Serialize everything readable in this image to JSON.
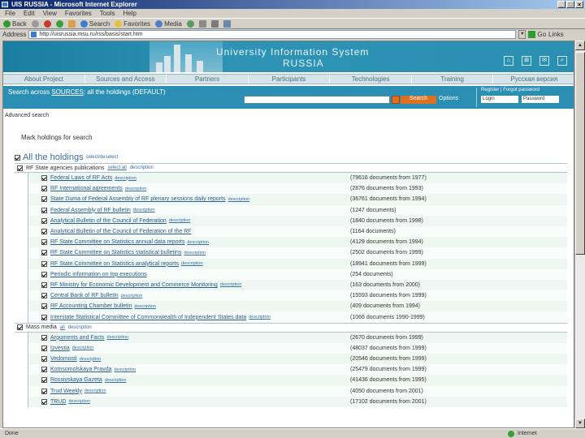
{
  "window": {
    "title": "UIS RUSSIA - Microsoft Internet Explorer",
    "menu": [
      "File",
      "Edit",
      "View",
      "Favorites",
      "Tools",
      "Help"
    ],
    "toolbar": {
      "back": "Back",
      "search": "Search",
      "favorites": "Favorites",
      "media": "Media"
    },
    "address": {
      "label": "Address",
      "url": "http://uisrussia.msu.ru/rss/basis/start.htm",
      "go": "Go",
      "links": "Links"
    },
    "status": {
      "left": "Done",
      "right": "Internet"
    }
  },
  "banner": {
    "line1": "University Information System",
    "line2": "RUSSIA"
  },
  "nav": [
    "About Project",
    "Sources and Access",
    "Partners",
    "Participants",
    "Technologies",
    "Training",
    "Русская версия"
  ],
  "search": {
    "prefix": "Search across",
    "link": "SOURCES",
    "suffix": ": all the holdings (DEFAULT)",
    "button": "Search",
    "options": "Options",
    "register": "Register | Forgot password",
    "login_placeholder": "Login",
    "password_placeholder": "Password"
  },
  "breadcrumb": "Advanced search",
  "section_title": "Mark holdings for search",
  "all_holdings": {
    "label": "All the holdings",
    "sub": "select/deselect"
  },
  "groups": [
    {
      "label": "RF State agencies publications",
      "select": "select all",
      "info": "description",
      "rows": [
        {
          "name": "Federal Laws of RF Acts",
          "desc": "description",
          "count": "(79616 documents from 1977)"
        },
        {
          "name": "RF International agreements",
          "desc": "description",
          "count": "(2876 documents from 1993)"
        },
        {
          "name": "State Duma of Federal Assembly of RF plenary sessions daily reports",
          "desc": "description",
          "count": "(36761 documents from 1994)"
        },
        {
          "name": "Federal Assembly of RF bulletin",
          "desc": "description",
          "count": "(1247 documents)"
        },
        {
          "name": "Analytical Bulletin of the Council of Federation",
          "desc": "description",
          "count": "(1840 documents from 1998)"
        },
        {
          "name": "Analytical Bulletin of the Council of Federation of the RF",
          "desc": "",
          "count": "(1164 documents)"
        },
        {
          "name": "RF State Committee on Statistics annual data reports",
          "desc": "description",
          "count": "(4129 documents from 1994)"
        },
        {
          "name": "RF State Committee on Statistics statistical bulletins",
          "desc": "description",
          "count": "(2502 documents from 1999)"
        },
        {
          "name": "RF State Committee on Statistics analytical reports",
          "desc": "description",
          "count": "(18941 documents from 1999)"
        },
        {
          "name": "Periodic information on top executions",
          "desc": "",
          "count": "(254 documents)"
        },
        {
          "name": "RF Ministry for Economic Development and Commerce Monitoring",
          "desc": "description",
          "count": "(163 documents from 2000)"
        },
        {
          "name": "Central Bank of RF bulletin",
          "desc": "description",
          "count": "(15593 documents from 1999)"
        },
        {
          "name": "RF Accounting Chamber bulletin",
          "desc": "description",
          "count": "(409 documents from 1994)"
        },
        {
          "name": "Interstate Statistical Committee of Commonwealth of Independent States data",
          "desc": "description",
          "count": "(1066 documents 1990-1999)"
        }
      ]
    },
    {
      "label": "Mass media",
      "select": "all",
      "info": "description",
      "rows": [
        {
          "name": "Arguments and Facts",
          "desc": "description",
          "count": "(2670 documents from 1999)"
        },
        {
          "name": "Izvestia",
          "desc": "description",
          "count": "(48037 documents from 1999)"
        },
        {
          "name": "Vedomosti",
          "desc": "description",
          "count": "(20546 documents from 1999)"
        },
        {
          "name": "Komsomolskaya Pravda",
          "desc": "description",
          "count": "(25479 documents from 1999)"
        },
        {
          "name": "Rossiyskaya Gazeta",
          "desc": "description",
          "count": "(41436 documents from 1995)"
        },
        {
          "name": "Trud Weekly",
          "desc": "description",
          "count": "(4050 documents from 2001)"
        },
        {
          "name": "TRUD",
          "desc": "description",
          "count": "(17102 documents from 2001)"
        }
      ]
    }
  ]
}
